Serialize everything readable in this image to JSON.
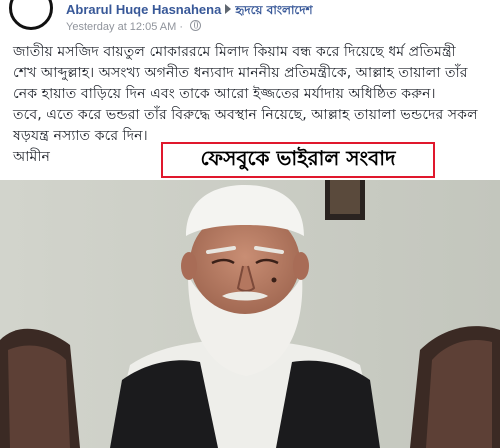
{
  "post": {
    "author": "Abrarul Huqe Hasnahena",
    "group": "হৃদয়ে বাংলাদেশ",
    "timestamp": "Yesterday at 12:05 AM",
    "privacy_icon": "globe-icon",
    "body_lines": [
      "জাতীয় মসজিদ বায়তুল মোকাররমে মিলাদ কিয়াম বন্ধ করে দিয়েছে ধর্ম প্রতিমন্ত্রী",
      "শেখ আব্দুল্লাহ। অসংখ্য অগনীত ধন্যবাদ মাননীয় প্রতিমন্ত্রীকে, আল্লাহ তায়ালা তাঁর",
      "নেক হায়াত বাড়িয়ে দিন এবং তাকে আরো ইজ্জতের মর্যাদায় অধিষ্ঠিত করুন।",
      "তবে, এতে করে ভন্ডরা তাঁর বিরুদ্ধে অবস্থান নিয়েছে, আল্লাহ তায়ালা ভন্ডদের সকল",
      "ষড়যন্ত্র নস্যাত করে দিন।",
      "আমীন"
    ]
  },
  "overlay": {
    "label": "ফেসবুকে ভাইরাল সংবাদ",
    "border_color": "#e0182d"
  },
  "colors": {
    "link": "#385898",
    "meta": "#90949c",
    "text": "#1d2129"
  }
}
